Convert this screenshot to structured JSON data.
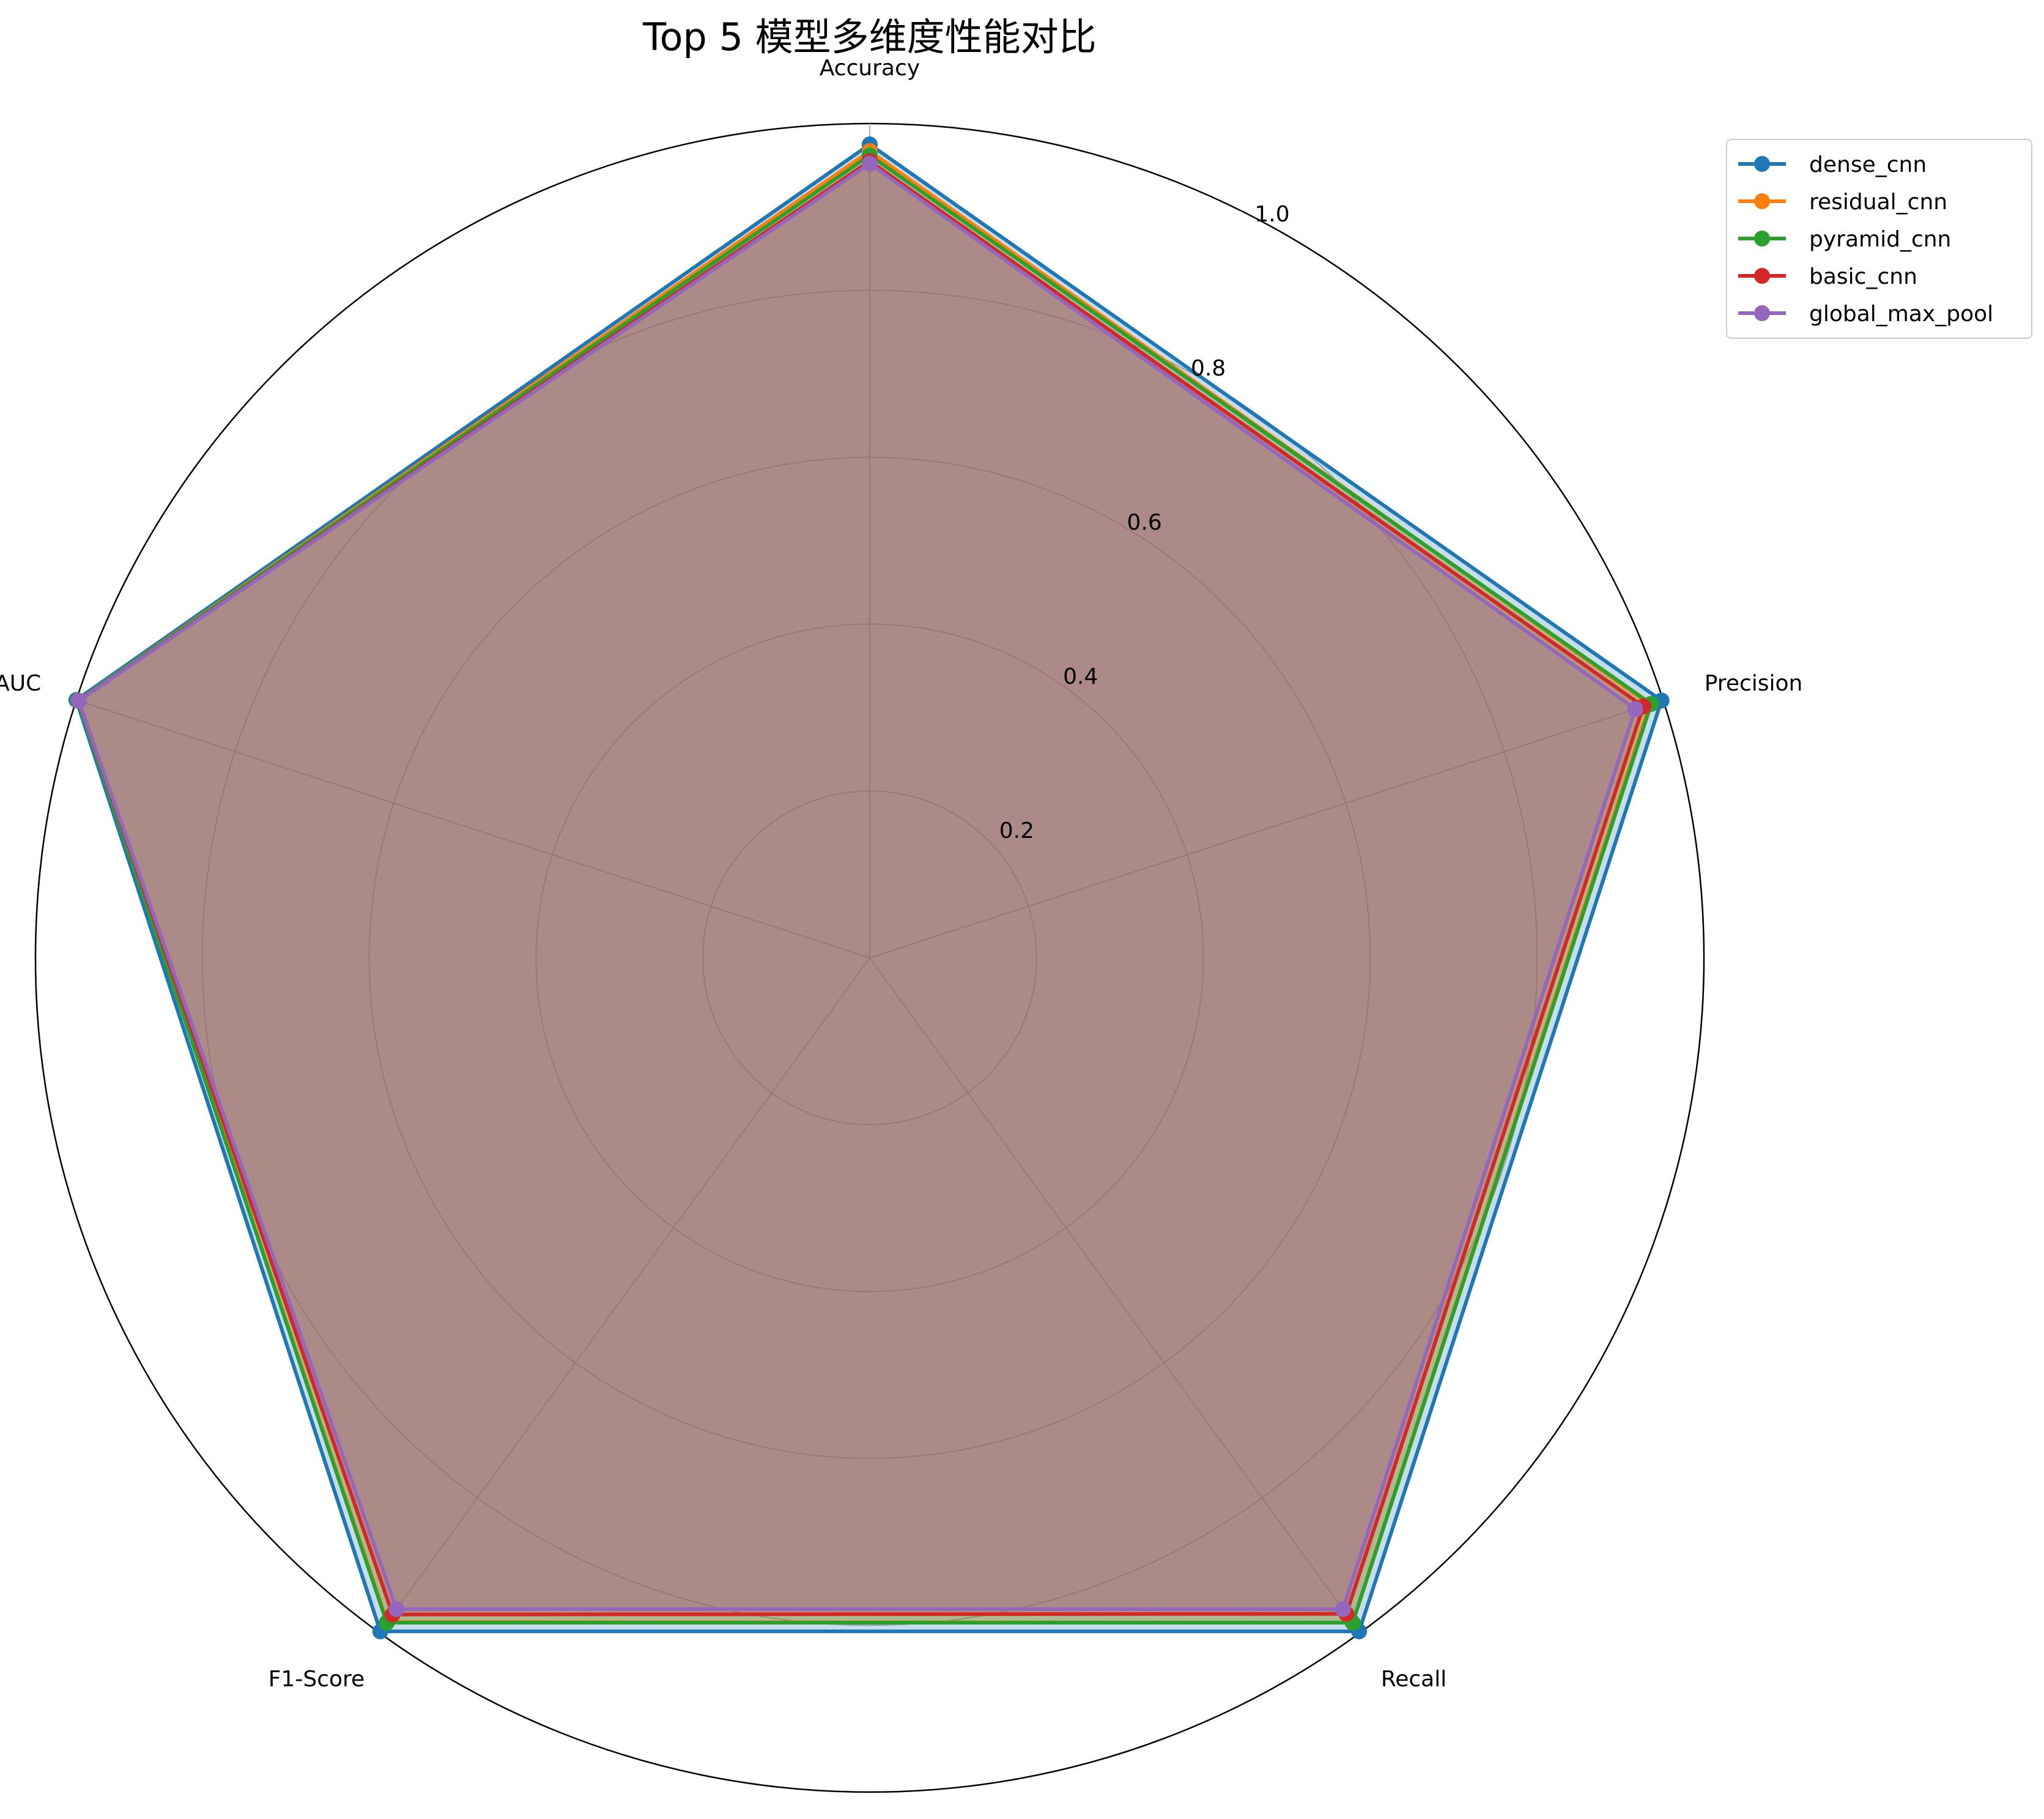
{
  "chart_data": {
    "type": "radar",
    "title": "Top 5 模型多维度性能对比",
    "axes": [
      "Accuracy",
      "Precision",
      "Recall",
      "F1-Score",
      "AUC"
    ],
    "radial_ticks": [
      "0.2",
      "0.4",
      "0.6",
      "0.8",
      "1.0"
    ],
    "radial_tick_values": [
      0.2,
      0.4,
      0.6,
      0.8,
      1.0
    ],
    "rlim": [
      0,
      1.0
    ],
    "grid": true,
    "legend_position": "top-right",
    "fill_alpha": 0.25,
    "series": [
      {
        "name": "dense_cnn",
        "color": "#1f77b4",
        "values": [
          0.975,
          0.998,
          0.998,
          0.998,
          1.0
        ]
      },
      {
        "name": "residual_cnn",
        "color": "#ff7f0e",
        "values": [
          0.967,
          0.983,
          0.985,
          0.984,
          0.998
        ]
      },
      {
        "name": "pyramid_cnn",
        "color": "#2ca02c",
        "values": [
          0.962,
          0.985,
          0.985,
          0.985,
          0.998
        ]
      },
      {
        "name": "basic_cnn",
        "color": "#d62728",
        "values": [
          0.955,
          0.975,
          0.972,
          0.973,
          0.997
        ]
      },
      {
        "name": "global_max_pool",
        "color": "#9467bd",
        "values": [
          0.952,
          0.965,
          0.965,
          0.965,
          0.997
        ]
      }
    ]
  }
}
